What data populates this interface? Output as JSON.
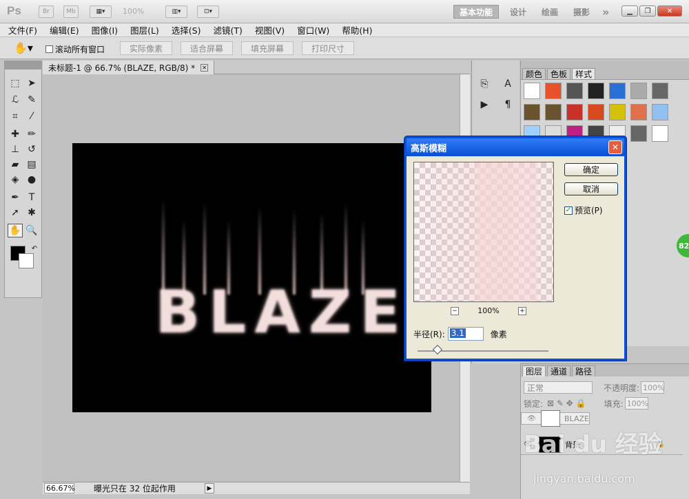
{
  "app": {
    "logo": "Ps",
    "zoom_display": "100%",
    "workspaces": [
      "基本功能",
      "设计",
      "绘画",
      "摄影"
    ],
    "more": "»"
  },
  "menu": [
    "文件(F)",
    "编辑(E)",
    "图像(I)",
    "图层(L)",
    "选择(S)",
    "滤镜(T)",
    "视图(V)",
    "窗口(W)",
    "帮助(H)"
  ],
  "options_bar": {
    "scroll_all_windows": "滚动所有窗口",
    "buttons": [
      "实际像素",
      "适合屏幕",
      "填充屏幕",
      "打印尺寸"
    ]
  },
  "document": {
    "tab_title": "未标题-1 @ 66.7% (BLAZE, RGB/8) *",
    "canvas_text": "BLAZE",
    "zoom_field": "66.67%",
    "status_message": "曝光只在 32 位起作用"
  },
  "styles_panel": {
    "tabs": [
      "颜色",
      "色板",
      "样式"
    ],
    "active_tab": "样式"
  },
  "layers_panel": {
    "tabs": [
      "图层",
      "通道",
      "路径"
    ],
    "blend_mode": "正常",
    "opacity_label": "不透明度:",
    "opacity_value": "100%",
    "lock_label": "锁定:",
    "fill_label": "填充:",
    "fill_value": "100%",
    "layers": [
      {
        "name": "BLAZE",
        "selected": true
      },
      {
        "name": "背景",
        "selected": false
      }
    ]
  },
  "dialog": {
    "title": "高斯模糊",
    "ok": "确定",
    "cancel": "取消",
    "preview_label": "预览(P)",
    "preview_checked": true,
    "zoom_value": "100%",
    "radius_label": "半径(R):",
    "radius_value": "3.1",
    "radius_unit": "像素"
  },
  "side_badge": "82",
  "watermark": {
    "main": "Bai du 经验",
    "url": "jingyan.baidu.com"
  }
}
